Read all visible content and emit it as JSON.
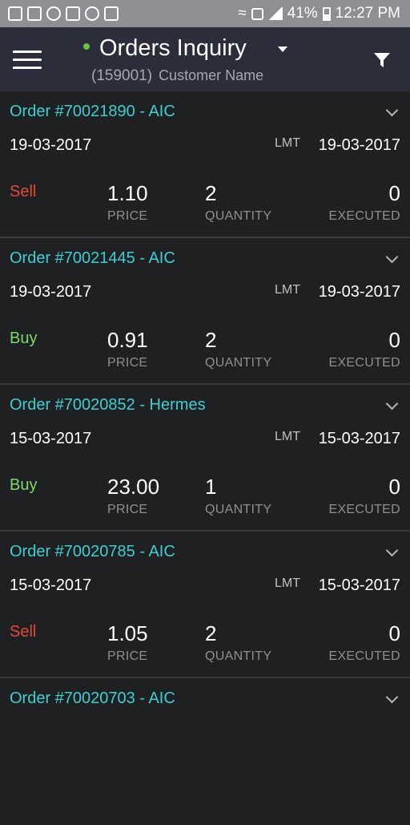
{
  "status_bar": {
    "battery": "41%",
    "time": "12:27 PM"
  },
  "app_bar": {
    "title": "Orders Inquiry",
    "customer_id": "(159001)",
    "customer_name": "Customer Name"
  },
  "labels": {
    "lmt": "LMT",
    "price": "PRICE",
    "quantity": "QUANTITY",
    "executed": "EXECUTED"
  },
  "colors": {
    "accent": "#3ecfd3",
    "sell": "#e2493a",
    "buy": "#7fd66a",
    "online": "#6bc33a"
  },
  "orders": [
    {
      "title": "Order #70021890 - AIC",
      "date": "19-03-2017",
      "lmt_date": "19-03-2017",
      "side": "Sell",
      "price": "1.10",
      "quantity": "2",
      "executed": "0"
    },
    {
      "title": "Order #70021445 - AIC",
      "date": "19-03-2017",
      "lmt_date": "19-03-2017",
      "side": "Buy",
      "price": "0.91",
      "quantity": "2",
      "executed": "0"
    },
    {
      "title": "Order #70020852 - Hermes",
      "date": "15-03-2017",
      "lmt_date": "15-03-2017",
      "side": "Buy",
      "price": "23.00",
      "quantity": "1",
      "executed": "0"
    },
    {
      "title": "Order #70020785 - AIC",
      "date": "15-03-2017",
      "lmt_date": "15-03-2017",
      "side": "Sell",
      "price": "1.05",
      "quantity": "2",
      "executed": "0"
    },
    {
      "title": "Order #70020703 - AIC"
    }
  ]
}
